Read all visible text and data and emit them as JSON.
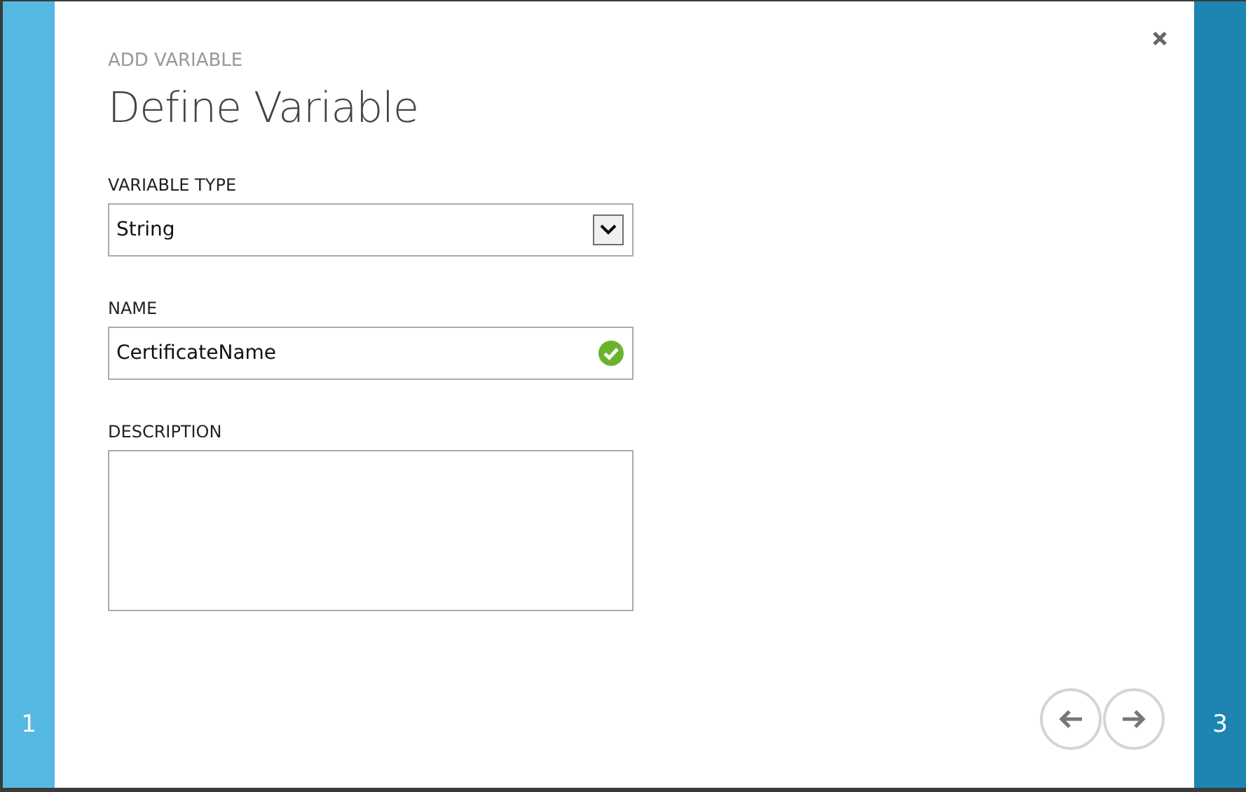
{
  "wizard": {
    "subtitle": "ADD VARIABLE",
    "title": "Define Variable",
    "previous_step": "1",
    "next_step": "3"
  },
  "fields": [
    {
      "kind": "dropdown",
      "label": "VARIABLE TYPE",
      "value": "String"
    },
    {
      "kind": "text",
      "label": "NAME",
      "value": "CertificateName",
      "valid": true
    },
    {
      "kind": "textarea",
      "label": "DESCRIPTION"
    }
  ]
}
